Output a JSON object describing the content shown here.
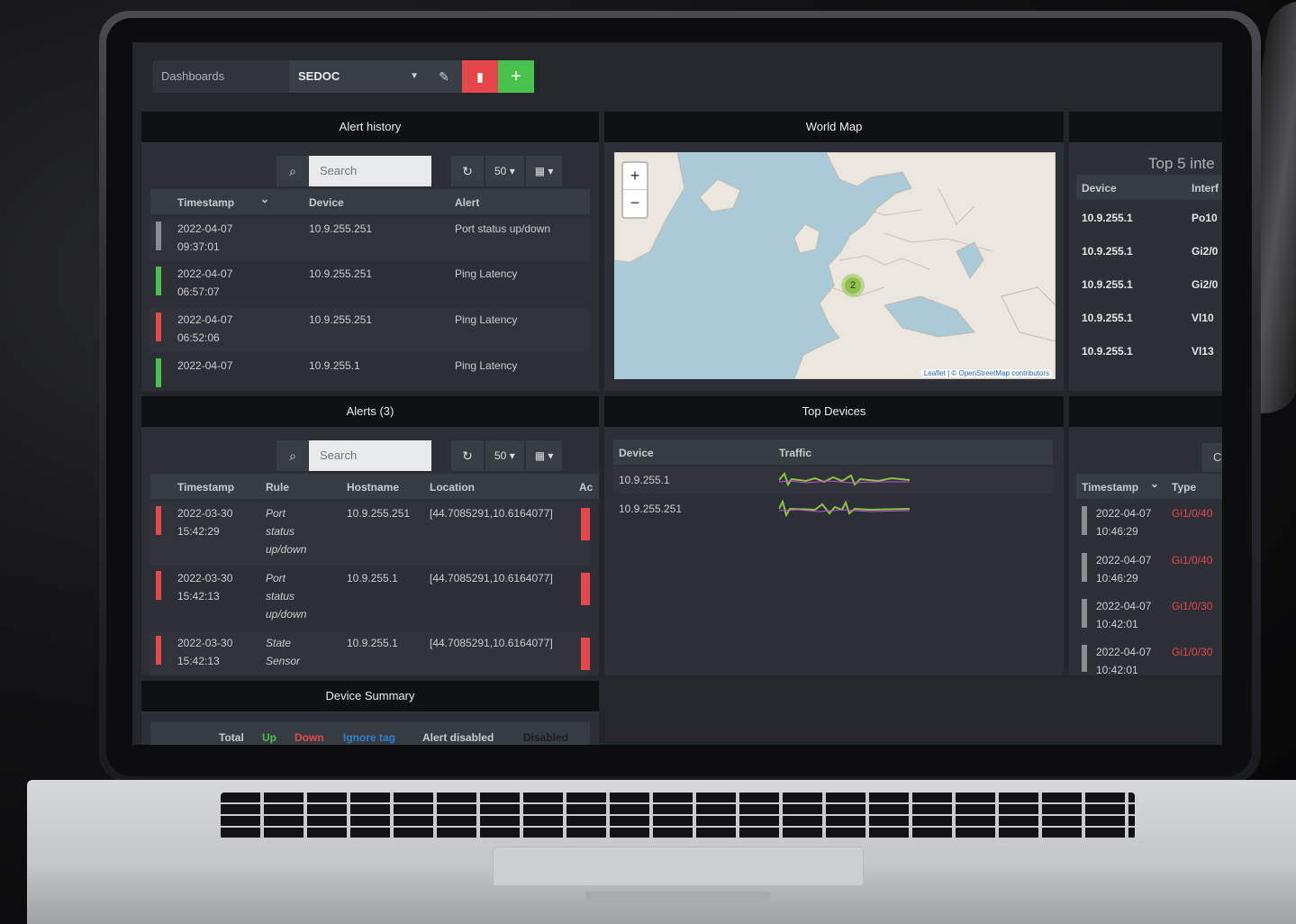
{
  "topbar": {
    "dashboards_label": "Dashboards",
    "selected_dashboard": "SEDOC"
  },
  "alert_history": {
    "title": "Alert history",
    "search_placeholder": "Search",
    "page_size": "50",
    "columns": [
      "Timestamp",
      "Device",
      "Alert"
    ],
    "rows": [
      {
        "date": "2022-04-07",
        "time": "09:37:01",
        "device": "10.9.255.251",
        "alert": "Port status up/down",
        "status": "grey"
      },
      {
        "date": "2022-04-07",
        "time": "06:57:07",
        "device": "10.9.255.251",
        "alert": "Ping Latency",
        "status": "green"
      },
      {
        "date": "2022-04-07",
        "time": "06:52:06",
        "device": "10.9.255.251",
        "alert": "Ping Latency",
        "status": "red"
      },
      {
        "date": "2022-04-07",
        "time": "",
        "device": "10.9.255.1",
        "alert": "Ping Latency",
        "status": "green"
      }
    ]
  },
  "world_map": {
    "title": "World Map",
    "cluster_count": "2",
    "attribution_leaflet": "Leaflet",
    "attribution_sep": " | © ",
    "attribution_osm": "OpenStreetMap",
    "attribution_tail": " contributors"
  },
  "top5": {
    "title": "Top 5 inte",
    "columns": [
      "Device",
      "Interf"
    ],
    "rows": [
      {
        "device": "10.9.255.1",
        "iface": "Po10"
      },
      {
        "device": "10.9.255.1",
        "iface": "Gi2/0"
      },
      {
        "device": "10.9.255.1",
        "iface": "Gi2/0"
      },
      {
        "device": "10.9.255.1",
        "iface": "Vl10"
      },
      {
        "device": "10.9.255.1",
        "iface": "Vl13"
      }
    ]
  },
  "alerts": {
    "title": "Alerts (3)",
    "search_placeholder": "Search",
    "page_size": "50",
    "columns": [
      "Timestamp",
      "Rule",
      "Hostname",
      "Location",
      "Ac"
    ],
    "rows": [
      {
        "date": "2022-03-30",
        "time": "15:42:29",
        "rule_l1": "Port",
        "rule_l2": "status",
        "rule_l3": "up/down",
        "host": "10.9.255.251",
        "location": "[44.7085291,10.6164077]"
      },
      {
        "date": "2022-03-30",
        "time": "15:42:13",
        "rule_l1": "Port",
        "rule_l2": "status",
        "rule_l3": "up/down",
        "host": "10.9.255.1",
        "location": "[44.7085291,10.6164077]"
      },
      {
        "date": "2022-03-30",
        "time": "15:42:13",
        "rule_l1": "State",
        "rule_l2": "Sensor",
        "rule_l3": "",
        "host": "10.9.255.1",
        "location": "[44.7085291,10.6164077]"
      }
    ]
  },
  "top_devices": {
    "title": "Top Devices",
    "columns": [
      "Device",
      "Traffic"
    ],
    "rows": [
      {
        "device": "10.9.255.1"
      },
      {
        "device": "10.9.255.251"
      }
    ]
  },
  "eventlog": {
    "columns": [
      "Timestamp",
      "Type"
    ],
    "rows": [
      {
        "date": "2022-04-07",
        "time": "10:46:29",
        "type": "Gi1/0/40"
      },
      {
        "date": "2022-04-07",
        "time": "10:46:29",
        "type": "Gi1/0/40"
      },
      {
        "date": "2022-04-07",
        "time": "10:42:01",
        "type": "Gi1/0/30"
      },
      {
        "date": "2022-04-07",
        "time": "10:42:01",
        "type": "Gi1/0/30"
      }
    ]
  },
  "device_summary": {
    "title": "Device Summary",
    "labels": [
      "Total",
      "Up",
      "Down",
      "Ignore tag",
      "Alert disabled",
      "Disabled"
    ]
  },
  "colors": {
    "up": "#48c24d",
    "down": "#e5474b",
    "ignore": "#2d7fd0",
    "accent_red": "#e5474b",
    "accent_green": "#48c24d"
  }
}
